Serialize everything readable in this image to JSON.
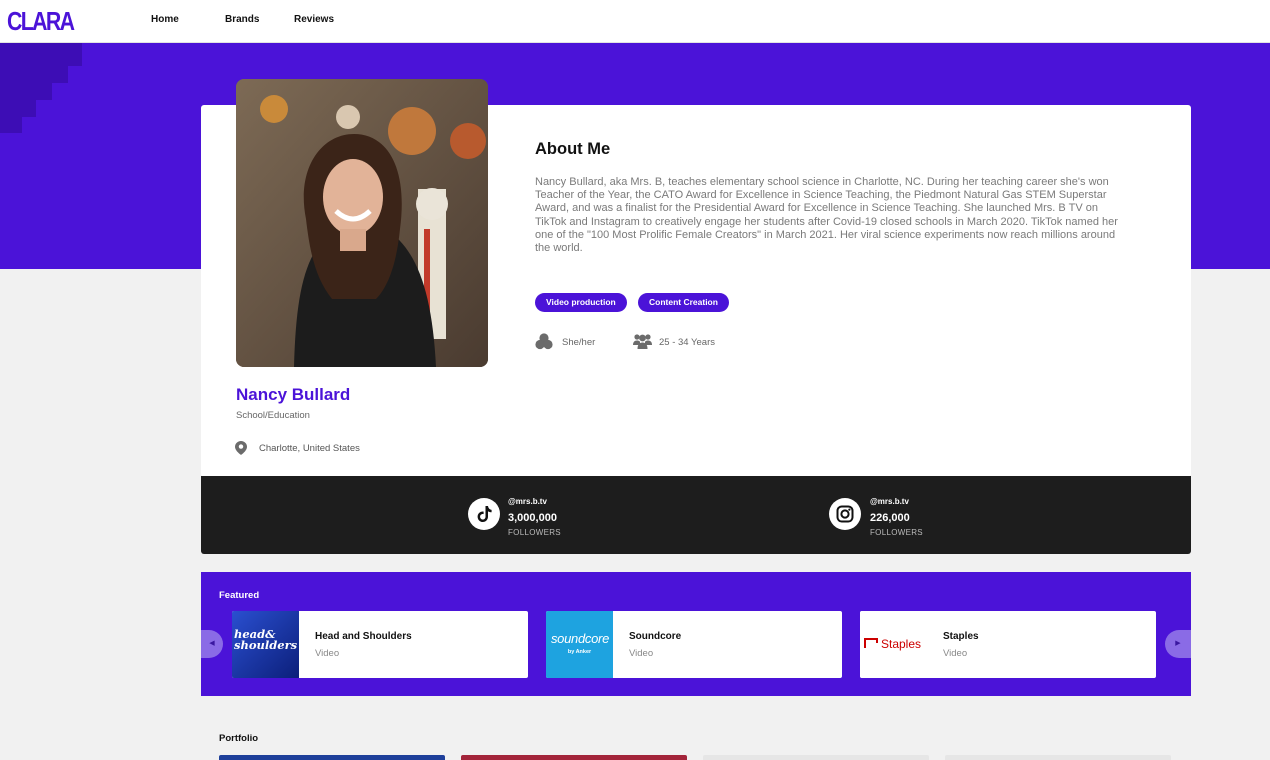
{
  "app": {
    "logo": "CLARA"
  },
  "nav": {
    "items": [
      "Home",
      "Brands",
      "Reviews"
    ]
  },
  "profile": {
    "name": "Nancy Bullard",
    "category": "School/Education",
    "location": "Charlotte, United States",
    "about_title": "About Me",
    "about_text": "Nancy Bullard, aka Mrs. B, teaches elementary school science in Charlotte, NC. During her teaching career she's won Teacher of the Year, the CATO Award for Excellence in Science Teaching, the Piedmont Natural Gas STEM Superstar Award, and was a finalist for the Presidential Award for Excellence in Science Teaching. She launched Mrs. B TV on TikTok and Instagram to creatively engage her students after Covid-19 closed schools in March 2020. TikTok named her one of the \"100 Most Prolific Female Creators\" in March 2021. Her viral science experiments now reach millions around the world.",
    "tags": [
      "Video production",
      "Content Creation"
    ],
    "pronouns": "She/her",
    "age_range": "25 - 34 Years"
  },
  "socials": [
    {
      "icon": "tiktok-icon",
      "handle": "@mrs.b.tv",
      "count": "3,000,000",
      "label": "FOLLOWERS"
    },
    {
      "icon": "instagram-icon",
      "handle": "@mrs.b.tv",
      "count": "226,000",
      "label": "FOLLOWERS"
    }
  ],
  "featured": {
    "title": "Featured",
    "items": [
      {
        "name": "Head and Shoulders",
        "type": "Video",
        "logo_text": "head& shoulders"
      },
      {
        "name": "Soundcore",
        "type": "Video",
        "logo_text": "soundcore",
        "logo_sub": "by Anker"
      },
      {
        "name": "Staples",
        "type": "Video",
        "logo_text": "Staples"
      }
    ]
  },
  "portfolio": {
    "title": "Portfolio"
  },
  "colors": {
    "brand": "#4b13d8",
    "dark_bar": "#1d1d1d",
    "staples_red": "#cc0000",
    "soundcore_blue": "#1ea3e0"
  }
}
